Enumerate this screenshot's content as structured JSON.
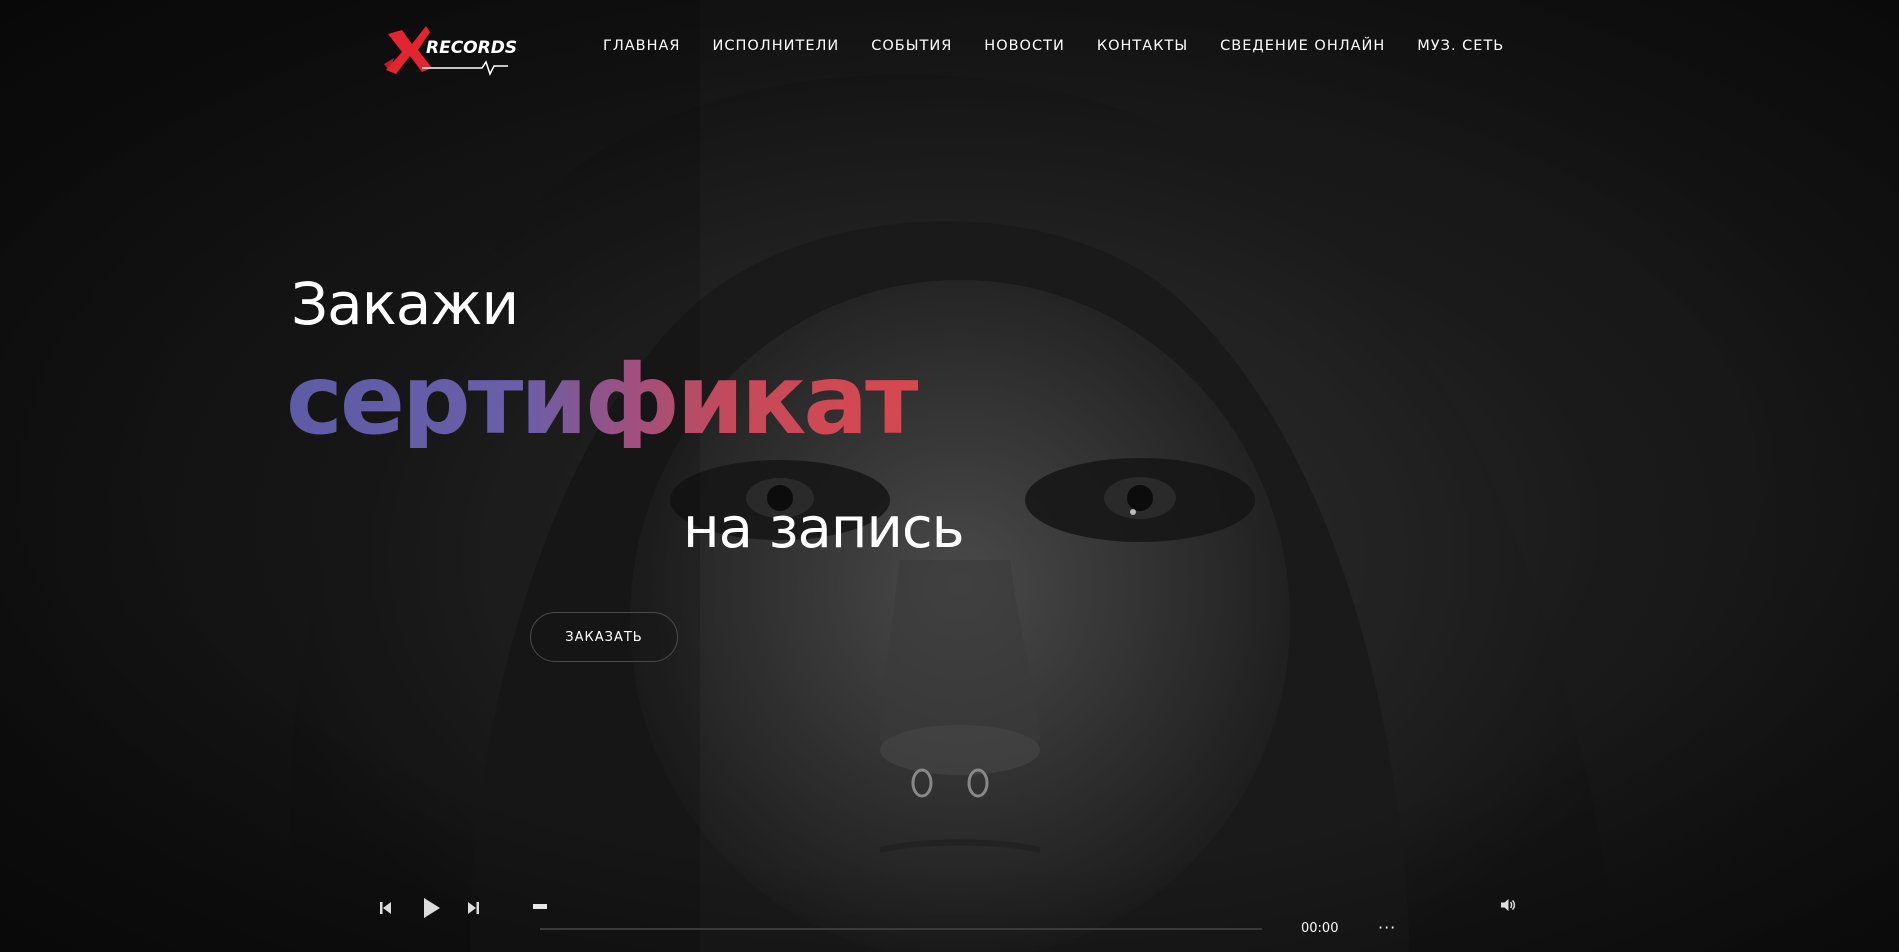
{
  "header": {
    "logo_text": "RECORDS",
    "nav": [
      {
        "label": "ГЛАВНАЯ"
      },
      {
        "label": "ИСПОЛНИТЕЛИ"
      },
      {
        "label": "СОБЫТИЯ"
      },
      {
        "label": "НОВОСТИ"
      },
      {
        "label": "КОНТАКТЫ"
      },
      {
        "label": "СВЕДЕНИЕ ОНЛАЙН"
      },
      {
        "label": "МУЗ. СЕТЬ"
      }
    ]
  },
  "hero": {
    "line1": "Закажи",
    "line2": "сертификат",
    "line3": "на запись",
    "cta_label": "ЗАКАЗАТЬ"
  },
  "player": {
    "time": "00:00",
    "progress": 0,
    "more_label": "···"
  },
  "colors": {
    "accent_red": "#d8484e",
    "accent_purple": "#5e5ca6",
    "background": "#141414"
  },
  "icons": {
    "prev": "skip-back-icon",
    "play": "play-icon",
    "next": "skip-forward-icon",
    "volume": "volume-icon",
    "more": "more-icon"
  }
}
